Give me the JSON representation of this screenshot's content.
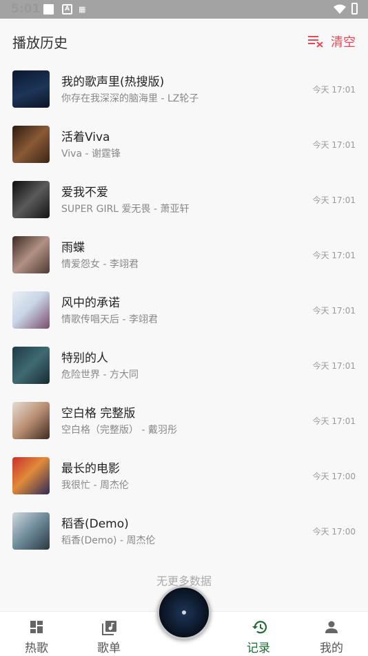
{
  "status_bar": {
    "time": "5:01"
  },
  "header": {
    "title": "播放历史",
    "clear_label": "清空"
  },
  "history": [
    {
      "title": "我的歌声里(热搜版)",
      "subtitle": "你存在我深深的脑海里 - LZ轮子",
      "time": "今天 17:01"
    },
    {
      "title": "活着Viva",
      "subtitle": "Viva - 谢霆锋",
      "time": "今天 17:01"
    },
    {
      "title": "爱我不爱",
      "subtitle": "SUPER GIRL 爱无畏 - 萧亚轩",
      "time": "今天 17:01"
    },
    {
      "title": "雨蝶",
      "subtitle": "情爱怨女 - 李翊君",
      "time": "今天 17:01"
    },
    {
      "title": "风中的承诺",
      "subtitle": "情歌传唱天后 - 李翊君",
      "time": "今天 17:01"
    },
    {
      "title": "特别的人",
      "subtitle": "危险世界 - 方大同",
      "time": "今天 17:01"
    },
    {
      "title": "空白格 完整版",
      "subtitle": "空白格（完整版） - 戴羽彤",
      "time": "今天 17:01"
    },
    {
      "title": "最长的电影",
      "subtitle": "我很忙 - 周杰伦",
      "time": "今天 17:00"
    },
    {
      "title": "稻香(Demo)",
      "subtitle": "稻香(Demo) - 周杰伦",
      "time": "今天 17:00"
    }
  ],
  "no_more": "无更多数据",
  "tabs": [
    {
      "label": "热歌",
      "icon": "dashboard-icon"
    },
    {
      "label": "歌单",
      "icon": "music-library-icon"
    },
    {
      "label": "记录",
      "icon": "history-icon",
      "active": true
    },
    {
      "label": "我的",
      "icon": "person-icon"
    }
  ],
  "colors": {
    "accent_red": "#e84855",
    "active_green": "#1f6b33"
  }
}
